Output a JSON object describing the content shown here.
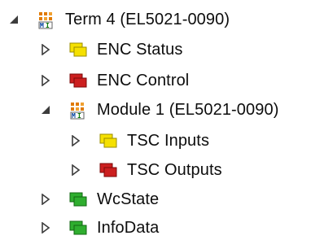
{
  "tree": {
    "items": [
      {
        "label": "Term 4 (EL5021-0090)",
        "icon": "terminal-module-icon",
        "expanded": true
      },
      {
        "label": "ENC Status",
        "icon": "input-variables-yellow-icon",
        "expanded": false
      },
      {
        "label": "ENC Control",
        "icon": "output-variables-red-icon",
        "expanded": false
      },
      {
        "label": "Module 1 (EL5021-0090)",
        "icon": "terminal-module-icon",
        "expanded": true
      },
      {
        "label": "TSC Inputs",
        "icon": "input-variables-yellow-icon",
        "expanded": false
      },
      {
        "label": "TSC Outputs",
        "icon": "output-variables-red-icon",
        "expanded": false
      },
      {
        "label": "WcState",
        "icon": "status-variables-green-icon",
        "expanded": false
      },
      {
        "label": "InfoData",
        "icon": "status-variables-green-icon",
        "expanded": false
      }
    ]
  },
  "colors": {
    "yellow": "#f5e000",
    "red": "#cc1f1f",
    "green": "#2fae2f",
    "module_orange": "#e07a00"
  }
}
